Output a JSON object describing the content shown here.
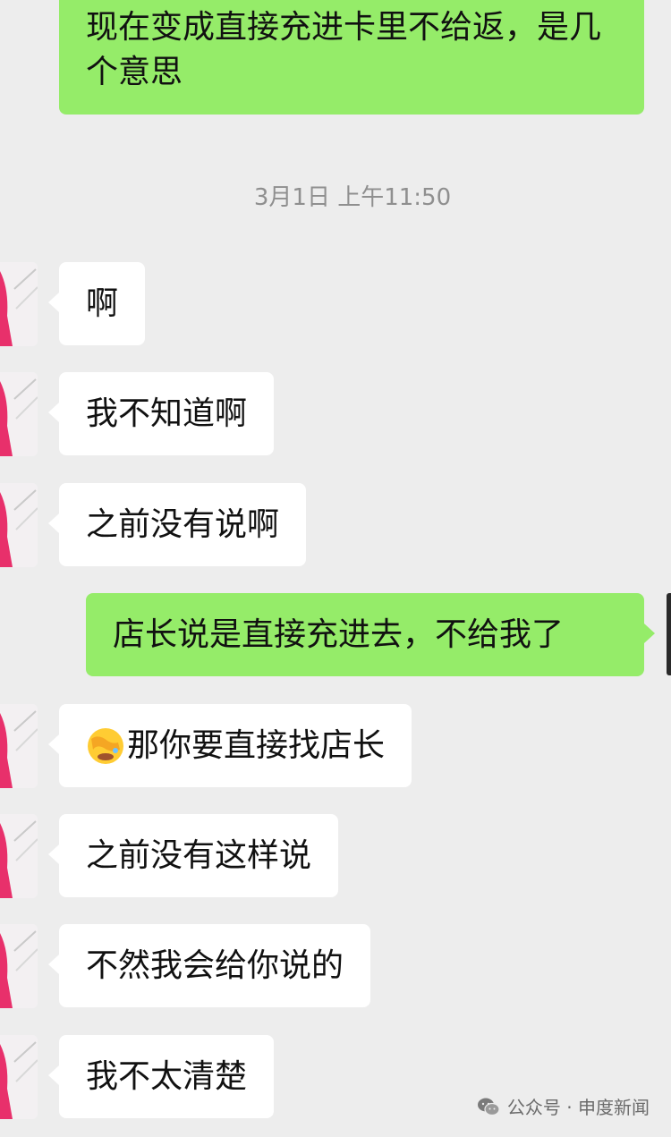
{
  "messages": [
    {
      "side": "out",
      "text": "现在变成直接充进卡里不给返，是几个意思"
    },
    {
      "side": "in",
      "text": "啊"
    },
    {
      "side": "in",
      "text": "我不知道啊"
    },
    {
      "side": "in",
      "text": "之前没有说啊"
    },
    {
      "side": "out",
      "text": "店长说是直接充进去，不给我了"
    },
    {
      "side": "in",
      "text": "那你要直接找店长",
      "emoji": "face-with-hand-over-eyes-icon"
    },
    {
      "side": "in",
      "text": "之前没有这样说"
    },
    {
      "side": "in",
      "text": "不然我会给你说的"
    },
    {
      "side": "in",
      "text": "我不太清楚"
    }
  ],
  "timestamp": "3月1日 上午11:50",
  "watermark": {
    "icon": "wechat-icon",
    "text": "公众号 · 申度新闻"
  },
  "colors": {
    "background": "#ededed",
    "outgoing_bubble": "#95ec69",
    "incoming_bubble": "#ffffff",
    "avatar_accent": "#e8306b"
  }
}
